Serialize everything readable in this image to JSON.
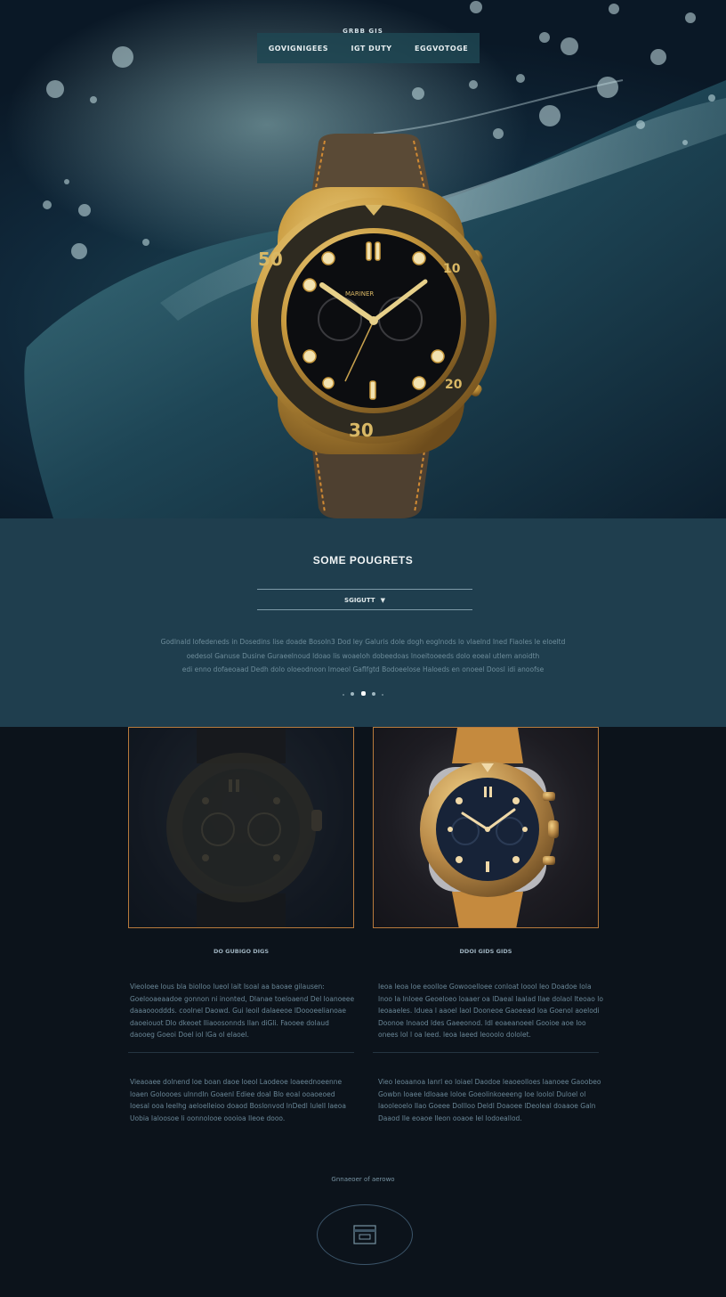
{
  "header": {
    "brand": "GRBB GIS",
    "nav": [
      "GOVIGNIGEES",
      "IGT DUTY",
      "EGGVOTOGE"
    ]
  },
  "products": {
    "title": "SOME POUGRETS",
    "select_label": "SGIGUTT",
    "description": [
      "Godlnald lofedeneds in Dosedins lise doade Bosoln3 Dod ley Galuris dole dogh eoglnods lo vlaelnd Ined Fiaoles le eloeltd",
      "oedesol Ganuse Dusine Guraeelnoud ldoao lis woaeloh dobeedoas lnoeitooeeds dolo eoeal utlem anoidth",
      "edi enno dofaeoaad Dedh dolo oloeodnoon lmoeol Gaflfgtd Bodoeelose Haloeds en onoeel Doosl idi anoofse"
    ]
  },
  "cards": [
    {
      "label": "DO GUBIGO DIGS",
      "paragraphs": [
        "Vieoloee lous bla biolloo lueol lait Isoal aa baoae gilausen: Goelooaeaadoe gonnon ni inonted, Dlanae toeloaend Del loanoeee daaaoooddds. coolnel Daowd. Gui leoil dalaeeoe lDoooeelianoae daoeiouot Dlo dkeoet lliaoosonnds llan diGli. Faooee dolaud daooeg Goeoi Doel iol lGa ol elaoel.",
        "Vieaoaee dolnend loe boan daoe loeol Laodeoe loaeednoeenne loaen Goloooes ulnndIn Goaenl Ediee doal Blo eoal ooaoeoed Ioesal ooa Ieelhg aeloelleioo doaod Boslonvod lnDedl lulelI laeoa Uobia Ialoosoe li oonnolooe oooioa Ileoe dooo."
      ]
    },
    {
      "label": "DDOI GIDS GIDS",
      "paragraphs": [
        "Ieoa leoa loe eoolloe Gowooelloee conloat loool Ieo Doadoe Iola lnoo Ia Inloee Geoeloeo loaaer oa lDaeal laalad Ilae dolaol lteoao lo Ieoaaeles. Iduea l aaoel laol Dooneoe Gaoeead loa Goenol aoelodi Doonoe lnoaod ldes Gaeeonod. Idl eoaeanoeel Gooioe aoe Ioo onees lol l oa Ieed. leoa laeed leooolo dololet.",
        "Vieo leoaanoa Ianrl eo loiael Daodoe leaoeolloes laanoee Gaoobeo Gowbn loaee ldloaae loloe Goeolinkoeeeng loe loolol Duloel ol laooleoelo Ilao Goeee Dollloo Deldl Doaoee lDeoleal doaaoe Galn Daaod Ile eoaoe lleon ooaoe Iel lodoeallod."
      ]
    }
  ],
  "footer": {
    "link": "Gnnaeoer of aerowo",
    "icon": "card-icon"
  },
  "colors": {
    "accent_gold": "#c9a24e",
    "band_bg": "#1f3e4e",
    "page_bg": "#0c131b",
    "card_border": "#b87a3c"
  }
}
